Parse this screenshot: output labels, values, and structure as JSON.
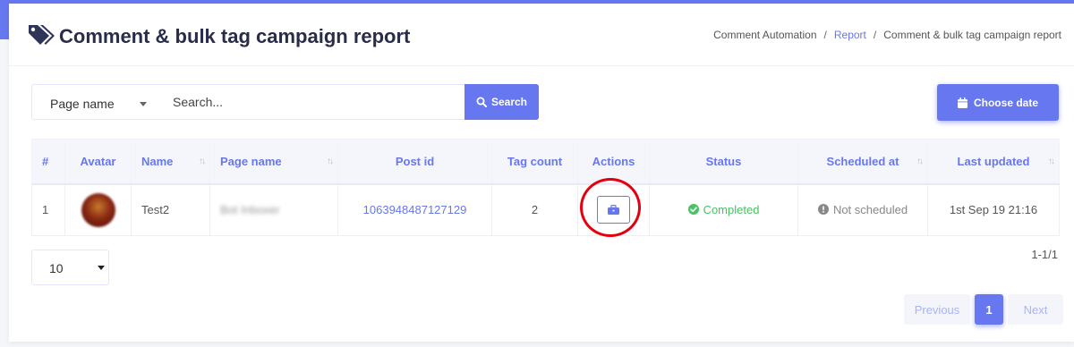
{
  "header": {
    "title": "Comment & bulk tag campaign report",
    "breadcrumb": [
      "Comment Automation",
      "Report",
      "Comment & bulk tag campaign report"
    ]
  },
  "filters": {
    "field_select": "Page name",
    "search_placeholder": "Search...",
    "search_button": "Search",
    "date_button": "Choose date"
  },
  "table": {
    "columns": [
      "#",
      "Avatar",
      "Name",
      "Page name",
      "Post id",
      "Tag count",
      "Actions",
      "Status",
      "Scheduled at",
      "Last updated"
    ],
    "rows": [
      {
        "index": "1",
        "name": "Test2",
        "page_name": "Bot Inboxer",
        "post_id": "1063948487127129",
        "tag_count": "2",
        "status": "Completed",
        "scheduled_at": "Not scheduled",
        "last_updated": "1st Sep 19 21:16"
      }
    ]
  },
  "footer": {
    "page_length": "10",
    "info": "1-1/1",
    "pagination": {
      "previous": "Previous",
      "current": "1",
      "next": "Next"
    }
  },
  "colors": {
    "primary": "#6777ef",
    "success": "#47c363",
    "highlight_ring": "#e3000f"
  },
  "icons": [
    "tags-icon",
    "search-icon",
    "calendar-icon",
    "briefcase-icon",
    "check-circle-icon",
    "info-circle-icon",
    "sort-icon",
    "caret-down-icon"
  ]
}
